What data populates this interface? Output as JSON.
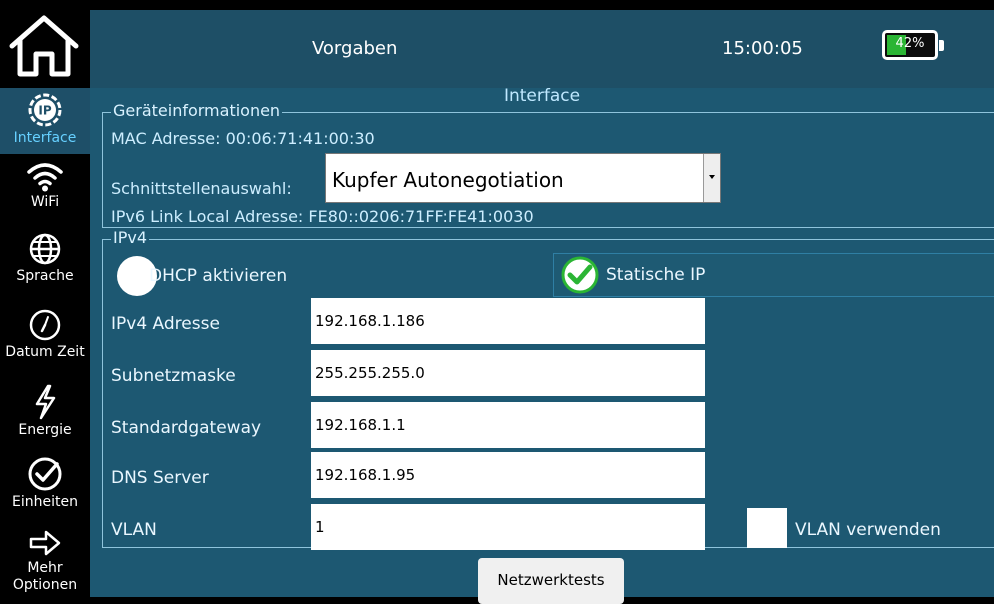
{
  "header": {
    "title": "Vorgaben",
    "time": "15:00:05",
    "battery": {
      "percent_text": "42%",
      "level": 0.42,
      "color": "#2bb534"
    }
  },
  "sidebar": {
    "home_icon": "home-icon",
    "items": [
      {
        "label": "Interface",
        "icon": "ip-icon",
        "active": true
      },
      {
        "label": "WiFi",
        "icon": "wifi-icon",
        "active": false
      },
      {
        "label": "Sprache",
        "icon": "globe-icon",
        "active": false
      },
      {
        "label": "Datum Zeit",
        "icon": "clock-icon",
        "active": false
      },
      {
        "label": "Energie",
        "icon": "lightning-icon",
        "active": false
      },
      {
        "label": "Einheiten",
        "icon": "check-circle-icon",
        "active": false
      },
      {
        "label": "Mehr Optionen",
        "icon": "arrow-right-icon",
        "active": false
      }
    ]
  },
  "main": {
    "heading": "Interface",
    "device_info": {
      "legend": "Geräteinformationen",
      "mac": "MAC Adresse: 00:06:71:41:00:30",
      "interface_select_label": "Schnittstellenauswahl:",
      "interface_select_value": "Kupfer Autonegotiation",
      "ipv6": "IPv6 Link Local Adresse: FE80::0206:71FF:FE41:0030"
    },
    "ipv4": {
      "legend": "IPv4",
      "dhcp_label": "DHCP aktivieren",
      "static_label": "Statische IP",
      "selected_mode": "Statische IP",
      "fields": [
        {
          "label": "IPv4 Adresse",
          "value": "192.168.1.186"
        },
        {
          "label": "Subnetzmaske",
          "value": "255.255.255.0"
        },
        {
          "label": "Standardgateway",
          "value": "192.168.1.1"
        },
        {
          "label": "DNS Server",
          "value": "192.168.1.95"
        },
        {
          "label": "VLAN",
          "value": "1"
        }
      ],
      "vlan_use_label": "VLAN verwenden",
      "vlan_use_checked": false
    },
    "network_tests_button": "Netzwerktests"
  },
  "colors": {
    "panel": "#1d5872",
    "header": "#1e4f66",
    "accent_check": "#2bb534"
  }
}
